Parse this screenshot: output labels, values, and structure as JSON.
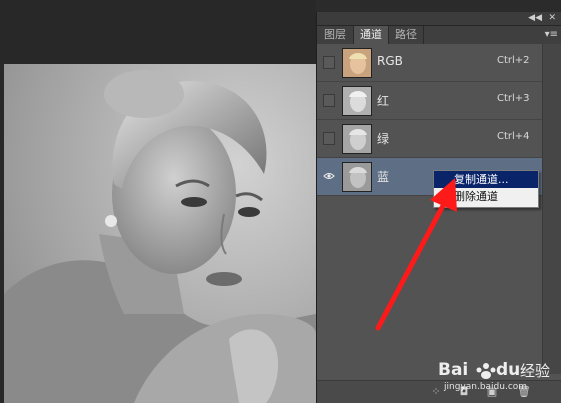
{
  "panel": {
    "collapse_icon": "double-chevron-left-icon",
    "close_icon": "double-x-icon",
    "tabs": [
      {
        "label": "图层",
        "active": false
      },
      {
        "label": "通道",
        "active": true
      },
      {
        "label": "路径",
        "active": false
      }
    ],
    "menu_icon": "panel-menu-icon",
    "channels": [
      {
        "name": "RGB",
        "shortcut": "Ctrl+2",
        "visible": false,
        "selected": false
      },
      {
        "name": "红",
        "shortcut": "Ctrl+3",
        "visible": false,
        "selected": false
      },
      {
        "name": "绿",
        "shortcut": "Ctrl+4",
        "visible": false,
        "selected": false
      },
      {
        "name": "蓝",
        "shortcut": "",
        "visible": true,
        "selected": true
      }
    ],
    "bottom_icons": [
      "load-selection-icon",
      "save-selection-icon",
      "new-channel-icon",
      "delete-channel-icon"
    ]
  },
  "context_menu": {
    "items": [
      {
        "label": "复制通道...",
        "highlighted": true
      },
      {
        "label": "删除通道",
        "highlighted": false
      }
    ]
  },
  "watermark": {
    "logo_text": "Bai du 经验",
    "url": "jingyan.baidu.com"
  },
  "colors": {
    "panel_bg": "#535353",
    "selected_row": "#5d6e85",
    "menu_highlight": "#0a246a",
    "arrow": "#ff1a1a"
  }
}
